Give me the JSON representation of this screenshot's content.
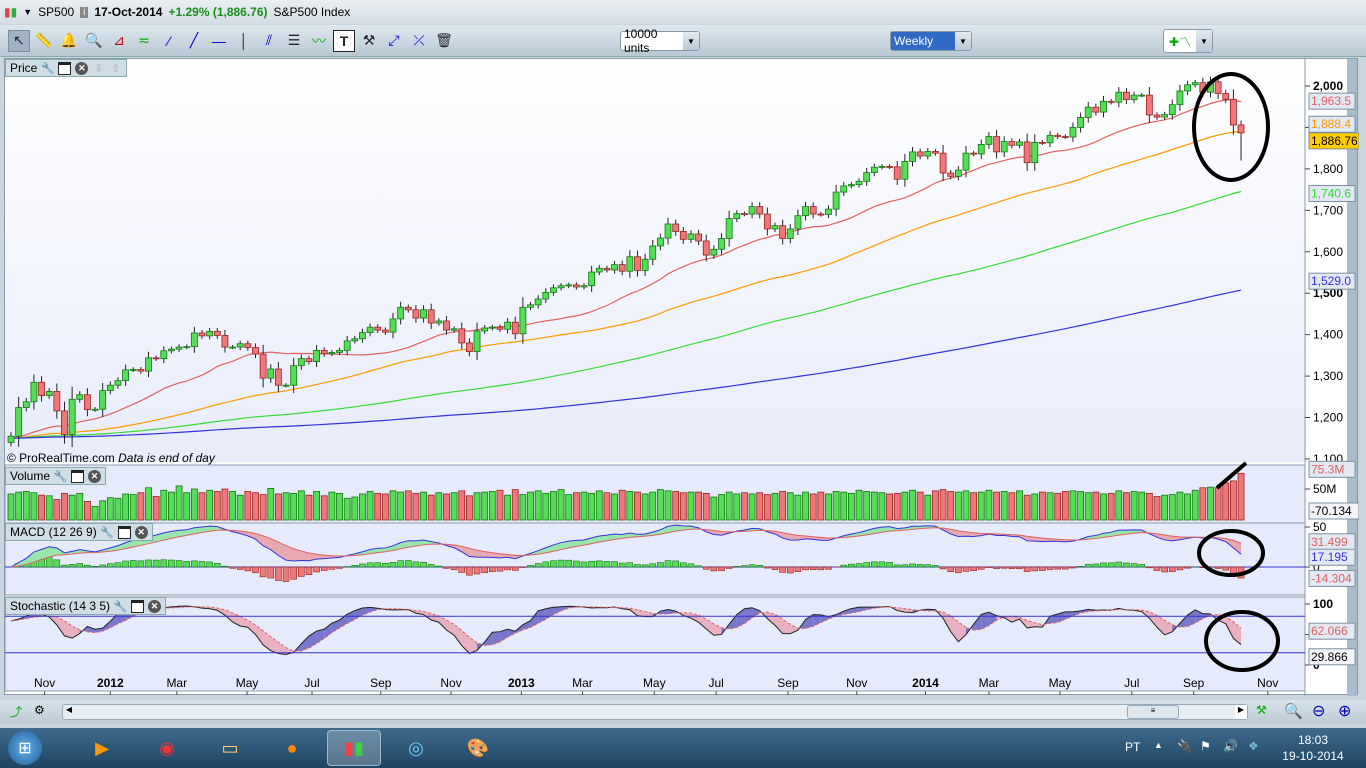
{
  "titlebar": {
    "symbol": "SP500",
    "date": "17-Oct-2014",
    "change": "+1.29% (1,886.76)",
    "name": "S&P500 Index"
  },
  "toolbar": {
    "units": "10000 units",
    "timeframe": "Weekly"
  },
  "panels": {
    "price": "Price",
    "volume": "Volume",
    "macd": "MACD (12 26 9)",
    "stoch": "Stochastic (14 3 5)",
    "credit": "© ProRealTime.com",
    "credit_note": "Data is end of day"
  },
  "price_axis": {
    "ticks": [
      "2,000",
      "1,900",
      "1,800",
      "1,700",
      "1,600",
      "1,500",
      "1,400",
      "1,300",
      "1,200",
      "1,100"
    ],
    "badges": {
      "ma20": "1,963.5",
      "ma50": "1,888.4",
      "ma100": "1,740.6",
      "ma200": "1,529.0",
      "last": "1,886.76"
    }
  },
  "volume_axis": {
    "tick": "50M",
    "badge": "75.3M",
    "value": "-70.134"
  },
  "macd_axis": {
    "ticks": [
      "50",
      "0"
    ],
    "badges": [
      "31.499",
      "17.195",
      "-14.304"
    ]
  },
  "stoch_axis": {
    "ticks": [
      "100",
      "50",
      "0"
    ],
    "badges": [
      "62.066",
      "29.866"
    ]
  },
  "x_axis": [
    "Nov",
    "2012",
    "Mar",
    "May",
    "Jul",
    "Sep",
    "Nov",
    "2013",
    "Mar",
    "May",
    "Jul",
    "Sep",
    "Nov",
    "2014",
    "Mar",
    "May",
    "Jul",
    "Sep",
    "Nov"
  ],
  "chart_data": {
    "type": "candlestick",
    "title": "SP500 Weekly",
    "first_open": 1140,
    "closes": [
      1155,
      1224,
      1238,
      1285,
      1253,
      1263,
      1216,
      1159,
      1244,
      1255,
      1219,
      1220,
      1265,
      1278,
      1289,
      1315,
      1316,
      1312,
      1344,
      1342,
      1361,
      1365,
      1370,
      1371,
      1404,
      1397,
      1408,
      1398,
      1370,
      1370,
      1378,
      1369,
      1353,
      1295,
      1317,
      1278,
      1278,
      1325,
      1342,
      1335,
      1362,
      1354,
      1357,
      1362,
      1385,
      1390,
      1405,
      1418,
      1411,
      1406,
      1438,
      1466,
      1460,
      1440,
      1460,
      1428,
      1433,
      1411,
      1414,
      1380,
      1359,
      1409,
      1416,
      1418,
      1413,
      1430,
      1402,
      1466,
      1472,
      1486,
      1502,
      1513,
      1518,
      1520,
      1515,
      1518,
      1551,
      1560,
      1556,
      1569,
      1553,
      1588,
      1555,
      1582,
      1614,
      1633,
      1667,
      1649,
      1630,
      1643,
      1626,
      1592,
      1606,
      1632,
      1680,
      1692,
      1691,
      1709,
      1691,
      1655,
      1663,
      1632,
      1655,
      1687,
      1709,
      1691,
      1690,
      1703,
      1744,
      1759,
      1762,
      1770,
      1791,
      1804,
      1806,
      1805,
      1775,
      1818,
      1841,
      1831,
      1842,
      1838,
      1790,
      1782,
      1797,
      1838,
      1836,
      1859,
      1878,
      1841,
      1866,
      1857,
      1865,
      1815,
      1864,
      1863,
      1881,
      1878,
      1877,
      1900,
      1924,
      1949,
      1937,
      1963,
      1961,
      1985,
      1967,
      1978,
      1978,
      1930,
      1925,
      1931,
      1955,
      1988,
      2003,
      2008,
      1985,
      2010,
      1982,
      1968,
      1906,
      1886.76
    ],
    "last_low": 1820,
    "volumes_m": [
      42,
      45,
      46,
      44,
      40,
      39,
      33,
      43,
      40,
      43,
      30,
      22,
      31,
      36,
      35,
      42,
      41,
      44,
      52,
      38,
      48,
      45,
      55,
      44,
      50,
      44,
      48,
      46,
      50,
      46,
      40,
      46,
      44,
      41,
      51,
      42,
      44,
      43,
      47,
      40,
      46,
      39,
      45,
      43,
      35,
      37,
      42,
      46,
      43,
      42,
      47,
      45,
      47,
      43,
      45,
      40,
      44,
      42,
      44,
      47,
      39,
      44,
      45,
      46,
      48,
      40,
      49,
      41,
      45,
      47,
      43,
      46,
      49,
      41,
      44,
      45,
      43,
      47,
      44,
      42,
      48,
      46,
      45,
      42,
      45,
      49,
      47,
      46,
      44,
      45,
      45,
      43,
      37,
      41,
      45,
      42,
      44,
      42,
      44,
      41,
      43,
      46,
      44,
      40,
      45,
      42,
      45,
      42,
      46,
      45,
      43,
      48,
      46,
      45,
      44,
      42,
      43,
      45,
      48,
      45,
      40,
      47,
      49,
      46,
      45,
      47,
      44,
      45,
      48,
      45,
      46,
      44,
      47,
      40,
      42,
      45,
      44,
      43,
      46,
      47,
      46,
      44,
      45,
      42,
      43,
      47,
      44,
      46,
      45,
      43,
      38,
      40,
      41,
      45,
      42,
      48,
      52,
      53,
      52,
      60,
      63,
      75.3
    ],
    "prehistory_level": 1150,
    "moving_averages": [
      {
        "period": 20,
        "color": "#e06060"
      },
      {
        "period": 50,
        "color": "#ff9900"
      },
      {
        "period": 100,
        "color": "#33dd33"
      },
      {
        "period": 200,
        "color": "#3333dd"
      }
    ],
    "ylim": [
      1100,
      2000
    ]
  }
}
